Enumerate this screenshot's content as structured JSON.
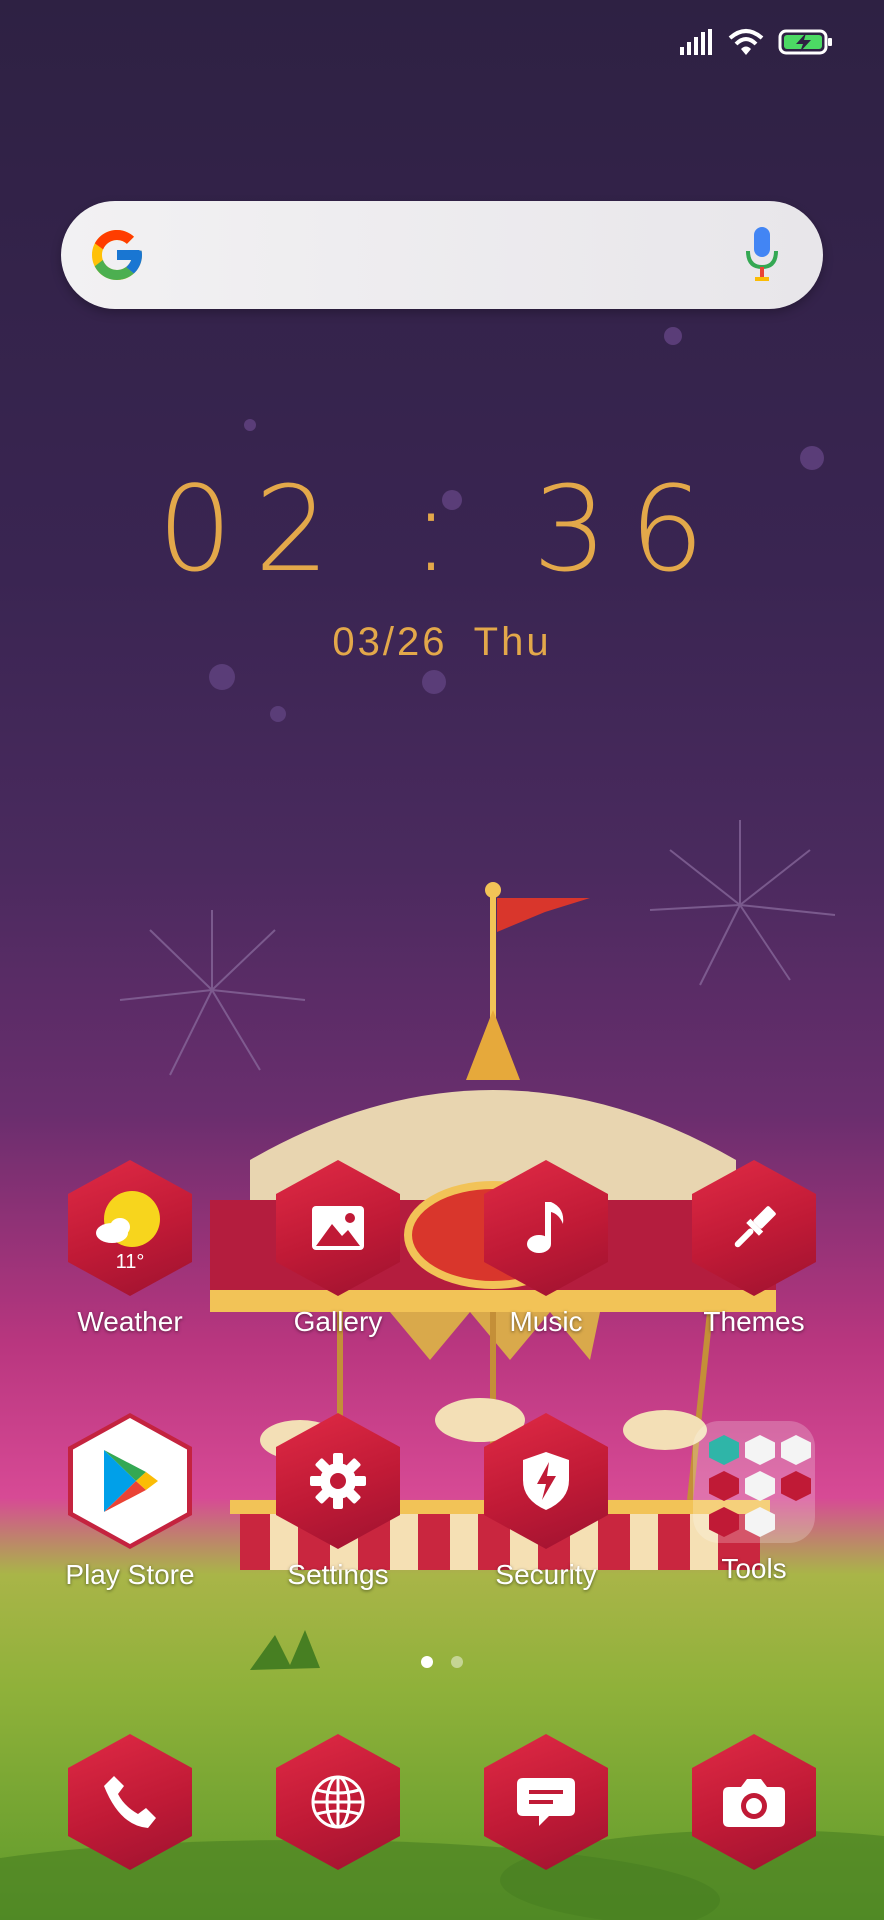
{
  "status": {
    "signal": "signal-icon",
    "wifi": "wifi-icon",
    "battery": "battery-charging-icon"
  },
  "search": {
    "google_icon": "google-g-icon",
    "mic_icon": "mic-icon"
  },
  "clock": {
    "time": "02 : 36",
    "date": "03/26",
    "day": "Thu"
  },
  "apps_row1": [
    {
      "label": "Weather",
      "temp": "11°"
    },
    {
      "label": "Gallery"
    },
    {
      "label": "Music"
    },
    {
      "label": "Themes"
    }
  ],
  "apps_row2": [
    {
      "label": "Play Store"
    },
    {
      "label": "Settings"
    },
    {
      "label": "Security"
    },
    {
      "label": "Tools"
    }
  ],
  "dock": [
    {
      "name": "phone"
    },
    {
      "name": "browser"
    },
    {
      "name": "messages"
    },
    {
      "name": "camera"
    }
  ],
  "pager": {
    "pages": 2,
    "current": 1
  },
  "colors": {
    "accent": "#e3a84a",
    "icon_red": "#c01a36"
  }
}
